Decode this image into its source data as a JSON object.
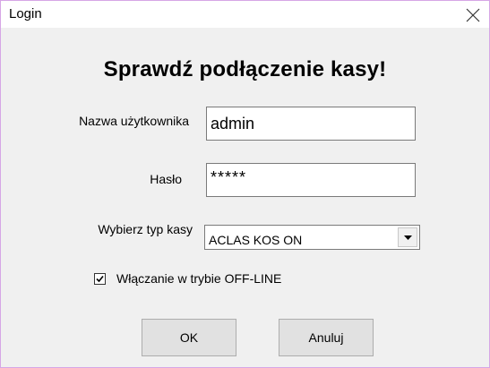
{
  "window": {
    "title": "Login",
    "close_icon": "close-icon"
  },
  "heading": "Sprawdź podłączenie kasy!",
  "form": {
    "username_label": "Nazwa użytkownika",
    "username_value": "admin",
    "password_label": "Hasło",
    "password_value": "*****",
    "register_type_label": "Wybierz typ kasy",
    "register_type_selected": "ACLAS KOS ON",
    "offline_checkbox_label": "Włączanie w trybie OFF-LINE",
    "offline_checked": true
  },
  "buttons": {
    "ok_label": "OK",
    "cancel_label": "Anuluj"
  },
  "colors": {
    "window_border": "#d6a6e6",
    "dialog_background": "#f0f0f0",
    "button_face": "#e1e1e1"
  }
}
